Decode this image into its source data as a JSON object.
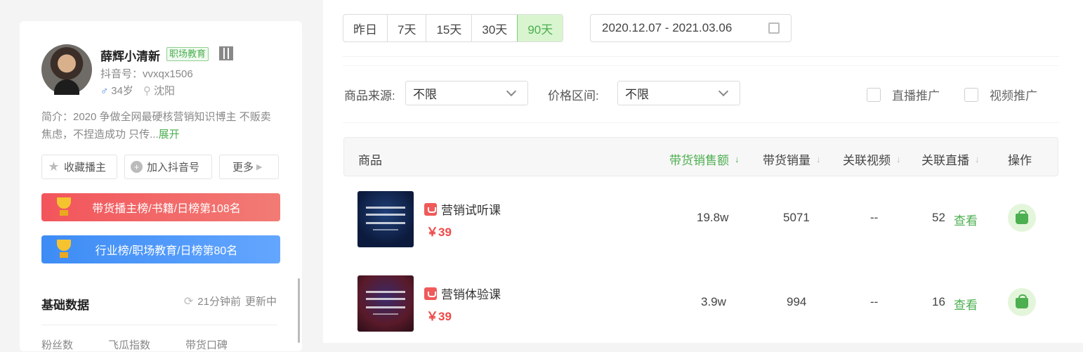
{
  "profile": {
    "name": "薛辉小清新",
    "tag": "职场教育",
    "douyin_id": "抖音号：vvxqx1506",
    "age": "34岁",
    "city": "沈阳",
    "intro": "简介：2020 争做全网最硬核营销知识博主 不贩卖焦虑，不捏造成功 只传...",
    "expand_label": "展开",
    "buttons": {
      "favorite": "收藏播主",
      "add_douyin": "加入抖音号",
      "more": "更多"
    },
    "rank_sales": "带货播主榜/书籍/日榜第108名",
    "rank_industry": "行业榜/职场教育/日榜第80名",
    "base_title": "基础数据",
    "update_time": "21分钟前",
    "update_status": "更新中",
    "stats": [
      "粉丝数",
      "飞瓜指数",
      "带货口碑"
    ]
  },
  "filters": {
    "ranges": [
      "昨日",
      "7天",
      "15天",
      "30天",
      "90天"
    ],
    "active_range": "90天",
    "date_range": "2020.12.07 - 2021.03.06",
    "source_label": "商品来源:",
    "source_value": "不限",
    "price_label": "价格区间:",
    "price_value": "不限",
    "live_promo": "直播推广",
    "video_promo": "视频推广"
  },
  "table": {
    "headers": {
      "product": "商品",
      "sales_amount": "带货销售额",
      "sales_volume": "带货销量",
      "related_videos": "关联视频",
      "related_live": "关联直播",
      "action": "操作"
    },
    "rows": [
      {
        "name": "营销试听课",
        "price": "￥39",
        "amount": "19.8w",
        "volume": "5071",
        "videos": "--",
        "live": "52",
        "view": "查看"
      },
      {
        "name": "营销体验课",
        "price": "￥39",
        "amount": "3.9w",
        "volume": "994",
        "videos": "--",
        "live": "16",
        "view": "查看"
      }
    ]
  }
}
